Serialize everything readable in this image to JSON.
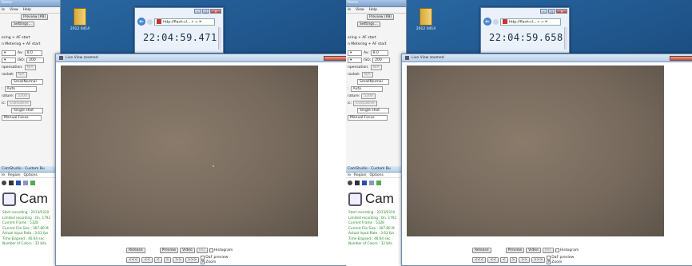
{
  "panels": [
    {
      "clock": "22:04:59.471",
      "desktop_icon": "2012 0414",
      "browser_url": "http://flash-cl... ⌕ → ✕",
      "live_view_title": "Live View zoomed",
      "background_app": {
        "title": "Remo",
        "menu": [
          "le",
          "View",
          "Help"
        ],
        "row1": [
          "Preview (PB)"
        ],
        "row2": [
          "Settings..."
        ],
        "text1": "ering + AF start",
        "text2": "n Metering + AF start",
        "av_label": "Av:",
        "av_value": "8.0",
        "iso_label": "ISO:",
        "iso_value": "200",
        "comp_label": "npensation:",
        "comp_value": "N/A",
        "bracket_label": "racket:",
        "bracket_value": "N/A",
        "quality": "SmallNormal",
        "wb_label": "Auto",
        "temp_label": "rature:",
        "temp_value": "5200",
        "metering_label": "ic:",
        "metering_value": "Evaluative",
        "drive": "Single shot",
        "focus": "Manual Focus"
      },
      "camstudio": {
        "title": "CamStudio - Custom Bu",
        "menu": [
          "le",
          "Region",
          "Options"
        ],
        "heading": "Cam",
        "stats": [
          "Start recording : 2013/0310",
          "Limited recording : On. 1792",
          "Current Frame : 5328",
          "Current File Size : 307.80 M",
          "Actual Input Rate : 3.63 fps",
          "Time Elapsed : 46.64 sec",
          "Number of Colors : 32 bits"
        ]
      }
    },
    {
      "clock": "22:04:59.658",
      "desktop_icon": "2012 0414",
      "browser_url": "http://flash-cl... ⌕ → ✕",
      "live_view_title": "Live View zoomed",
      "background_app": {
        "title": "Remo",
        "menu": [
          "le",
          "View",
          "Help"
        ],
        "row1": [
          "Preview (PB)"
        ],
        "row2": [
          "Settings..."
        ],
        "text1": "ering + AF start",
        "text2": "n Metering + AF start",
        "av_label": "Av:",
        "av_value": "8.0",
        "iso_label": "ISO:",
        "iso_value": "200",
        "comp_label": "npensation:",
        "comp_value": "N/A",
        "bracket_label": "racket:",
        "bracket_value": "N/A",
        "quality": "SmallNormal",
        "wb_label": "Auto",
        "temp_label": "rature:",
        "temp_value": "5200",
        "metering_label": "ic:",
        "metering_value": "Evaluative",
        "drive": "Single shot",
        "focus": "Manual Focus"
      },
      "camstudio": {
        "title": "CamStudio - Custom Bu",
        "menu": [
          "le",
          "Region",
          "Options"
        ],
        "heading": "Cam",
        "stats": [
          "Start recording : 2013/0310",
          "Limited recording : On. 1792",
          "Current Frame : 5328",
          "Current File Size : 307.80 M",
          "Actual Input Rate : 3.63 fps",
          "Time Elapsed : 46.64 sec",
          "Number of Colors : 32 bits"
        ]
      }
    }
  ],
  "live_view_controls": {
    "release": "Release",
    "preview": "Preview",
    "video": "Video",
    "rec": "Rec",
    "histogram": "Histogram",
    "daf_preview": "DaF preview",
    "zoom": "Zoom",
    "nav": [
      "<<<",
      "<<",
      "<",
      ">",
      ">>",
      ">>>"
    ]
  },
  "colors": {
    "desktop": "#1c4f83",
    "live_view_image": "#776a5d",
    "teal_corner": "#35a8b3",
    "clock_text": "#1a2f4a"
  }
}
